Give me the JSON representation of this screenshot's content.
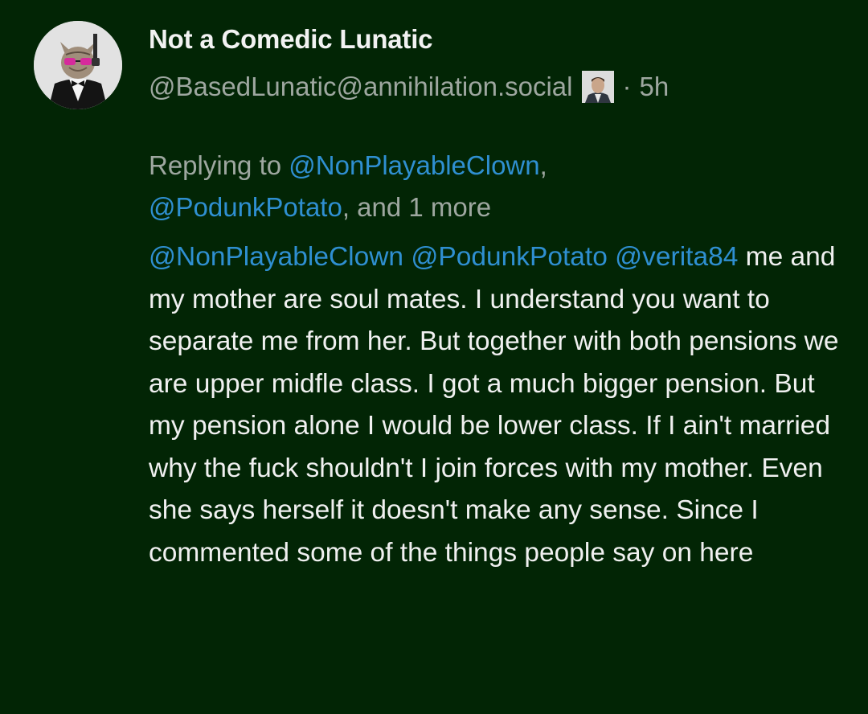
{
  "post": {
    "display_name": "Not a Comedic Lunatic",
    "handle": "@BasedLunatic@annihilation.social",
    "separator": "·",
    "time": "5h",
    "avatar_icon": "cat-in-tuxedo-avatar",
    "badge_icon": "man-in-suit-emoji"
  },
  "reply": {
    "prefix": "Replying to",
    "mention1": "@NonPlayableClown",
    "comma": ",",
    "mention2": "@PodunkPotato",
    "suffix": ", and 1 more"
  },
  "content": {
    "mention1": "@NonPlayableClown",
    "mention2": "@PodunkPotato",
    "mention3": "@verita84",
    "text": " me and my mother are soul mates. I understand you want to separate me from her. But together with both pensions we are upper midfle class. I got a much bigger pension. But my pension alone I would be lower class. If I ain't married why the fuck shouldn't I join forces with my mother. Even she says herself it doesn't make any sense. Since I commented some of the things people say on here"
  },
  "colors": {
    "background": "#022505",
    "mention": "#2f8fd1",
    "muted": "#9ea7a0",
    "text": "#f0f0f0"
  }
}
